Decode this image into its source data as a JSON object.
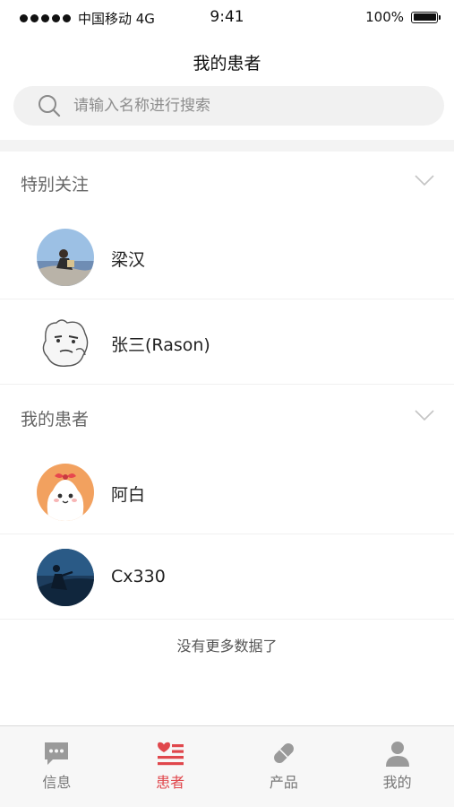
{
  "status_bar": {
    "carrier": "中国移动 4G",
    "time": "9:41",
    "battery": "100%",
    "battery_level": 1.0
  },
  "nav": {
    "title": "我的患者"
  },
  "search": {
    "placeholder": "请输入名称进行搜索"
  },
  "sections": [
    {
      "title": "特别关注",
      "patients": [
        {
          "name": "梁汉"
        },
        {
          "name": "张三(Rason)"
        }
      ]
    },
    {
      "title": "我的患者",
      "patients": [
        {
          "name": "阿白"
        },
        {
          "name": "Cx330"
        }
      ]
    }
  ],
  "footer_note": "没有更多数据了",
  "tab_bar": {
    "active_color": "#e0474c",
    "items": [
      {
        "label": "信息",
        "icon": "chat-icon",
        "active": false
      },
      {
        "label": "患者",
        "icon": "patient-list-icon",
        "active": true
      },
      {
        "label": "产品",
        "icon": "pill-icon",
        "active": false
      },
      {
        "label": "我的",
        "icon": "user-icon",
        "active": false
      }
    ]
  }
}
